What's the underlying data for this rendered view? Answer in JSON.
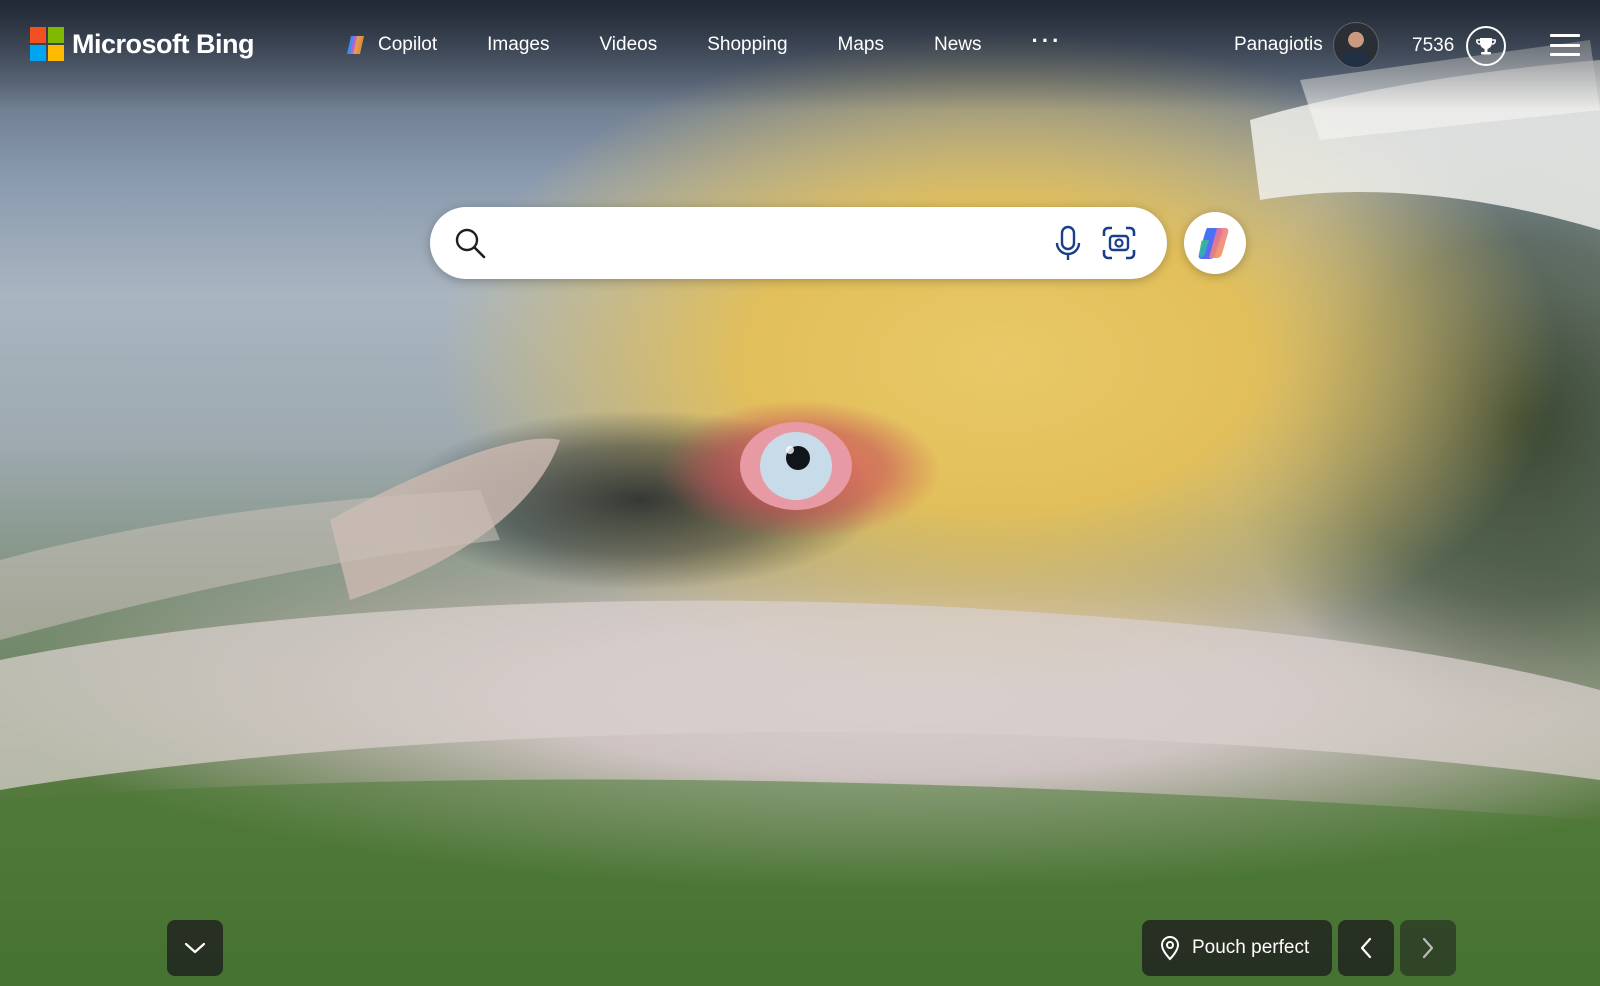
{
  "header": {
    "brand": "Microsoft Bing",
    "nav": {
      "copilot": "Copilot",
      "images": "Images",
      "videos": "Videos",
      "shopping": "Shopping",
      "maps": "Maps",
      "news": "News",
      "more": "···"
    },
    "user_name": "Panagiotis",
    "rewards_points": "7536"
  },
  "search": {
    "value": "",
    "placeholder": ""
  },
  "image_caption": {
    "title": "Pouch perfect"
  },
  "colors": {
    "ms_red": "#f25022",
    "ms_green": "#7fba00",
    "ms_blue": "#00a4ef",
    "ms_yellow": "#ffb900",
    "search_icon": "#1f1f1f",
    "mic_icon": "#1a3e8c",
    "visual_icon": "#1a3e8c",
    "control_bg": "#1e1e1e"
  },
  "icons": {
    "search": "search-icon",
    "mic": "microphone-icon",
    "visual_search": "visual-search-icon",
    "copilot": "copilot-icon",
    "trophy": "rewards-trophy-icon",
    "menu": "hamburger-menu-icon",
    "location": "location-pin-icon",
    "scroll_down": "chevron-down-icon",
    "previous": "chevron-left-icon",
    "next": "chevron-right-icon"
  }
}
